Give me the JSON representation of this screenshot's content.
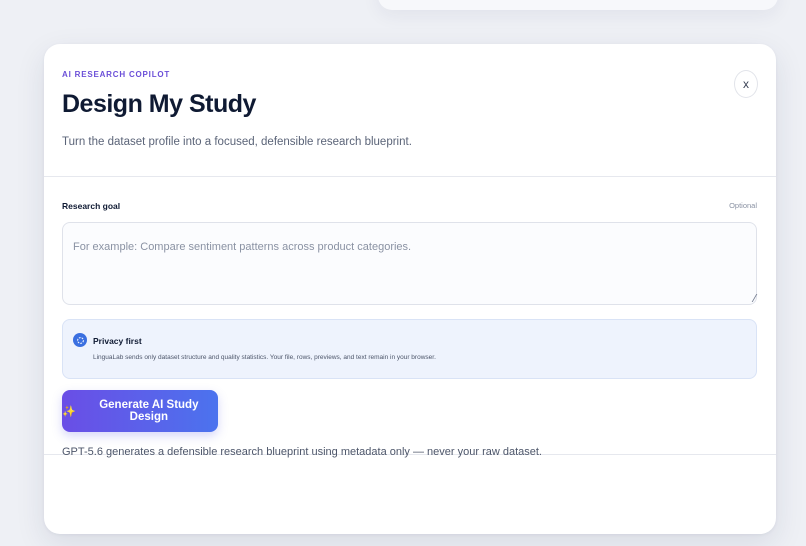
{
  "modal": {
    "eyebrow": "AI RESEARCH COPILOT",
    "title": "Design My Study",
    "subtitle": "Turn the dataset profile into a focused, defensible research blueprint.",
    "close_label": "x"
  },
  "goal": {
    "label": "Research goal",
    "optional": "Optional",
    "placeholder": "For example: Compare sentiment patterns across product categories.",
    "value": ""
  },
  "privacy": {
    "title": "Privacy first",
    "text": "LinguaLab sends only dataset structure and quality statistics. Your file, rows, previews, and text remain in your browser.",
    "icon": "shield-icon"
  },
  "generate": {
    "icon": "✨",
    "label": "Generate AI Study Design"
  },
  "footer": {
    "note": "GPT-5.6 generates a defensible research blueprint using metadata only — never your raw dataset."
  },
  "colors": {
    "accent": "#6b4fd8",
    "button_start": "#6a4ee6",
    "button_end": "#4b73ee",
    "privacy_bg": "#eef3fd"
  }
}
